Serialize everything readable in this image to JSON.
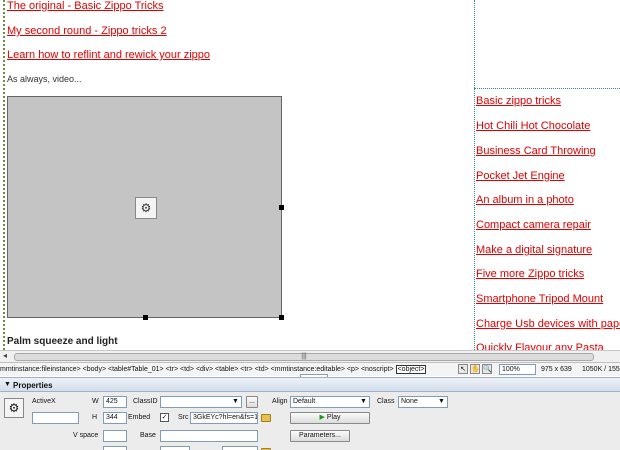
{
  "design": {
    "links_top": [
      "The original - Basic Zippo Tricks",
      "My second round - Zippo tricks 2",
      "Learn how to reflint and rewick your zippo"
    ],
    "paragraph": "As always, video...",
    "caption": "Palm squeeze and light",
    "sidebar_links": [
      "Basic zippo tricks",
      "Hot Chili Hot Chocolate",
      "Business Card Throwing",
      "Pocket Jet Engine",
      "An album in a photo",
      "Compact camera repair",
      "Make a digital signature",
      "Five more Zippo tricks",
      "Smartphone Tripod Mount",
      "Charge Usb devices with pape",
      "Quickly Flavour any Pasta"
    ],
    "link_color": "#e00000"
  },
  "hscroll": {
    "thumb_grip": "|||"
  },
  "status_bar": {
    "tag_path": "mmtinstance:fileinstance> <body> <table#Table_01> <tr> <td> <div> <table> <tr> <td> <mmtinstance:editable> <p> <noscript>",
    "selected_tag": "<object>",
    "zoom": "100%",
    "dimensions": "975 x 639",
    "filesize": "1050K / 155"
  },
  "properties": {
    "title": "Properties",
    "activex_label": "ActiveX",
    "w_label": "W",
    "w_value": "425",
    "h_label": "H",
    "h_value": "344",
    "classid_label": "ClassID",
    "classid_value": "",
    "embed_label": "Embed",
    "embed_checked": "✓",
    "src_label": "Src",
    "src_value": "3GkEYc?hl=en&fs=1",
    "align_label": "Align",
    "align_value": "Default",
    "class_label": "Class",
    "class_value": "None",
    "play_label": "Play",
    "vspace_label": "V space",
    "base_label": "Base",
    "parameters_label": "Parameters...",
    "browse_label": "..."
  }
}
